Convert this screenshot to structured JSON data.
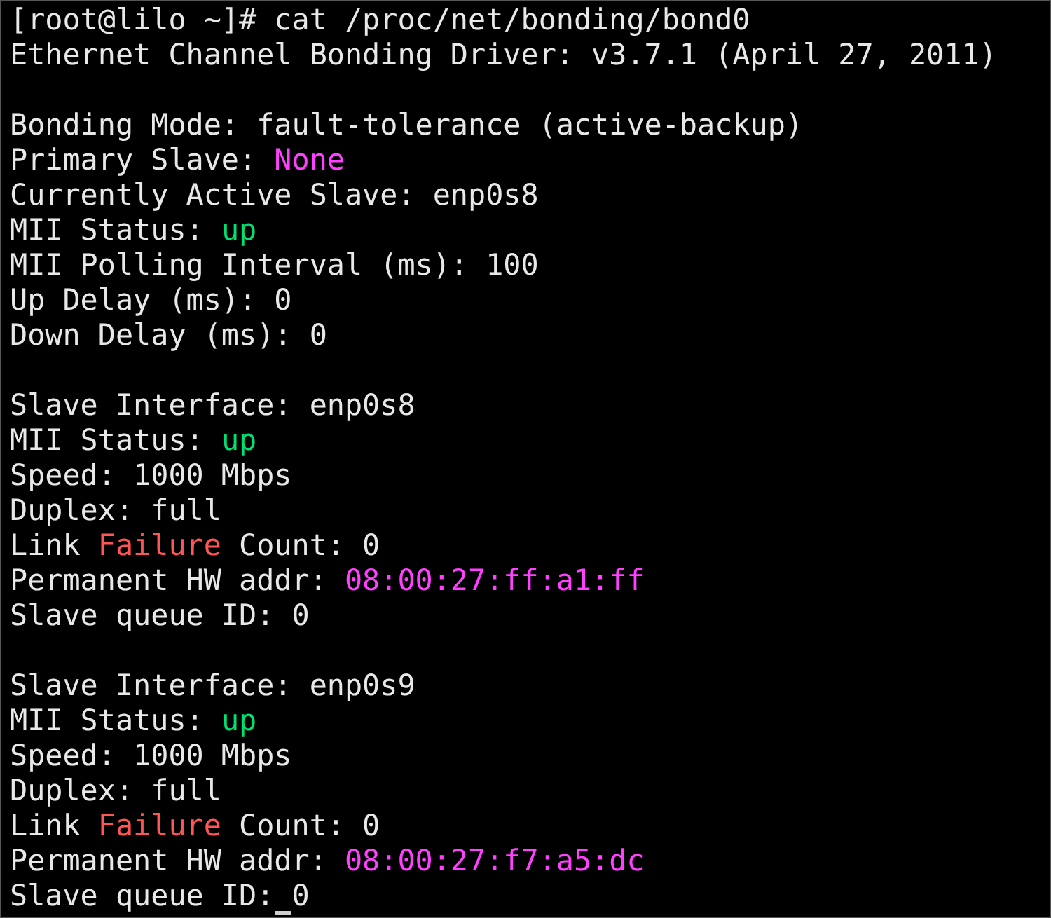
{
  "terminal": {
    "lines": [
      {
        "kind": "text",
        "segments": [
          {
            "text": "[root@lilo ~]# cat /proc/net/bonding/bond0"
          }
        ]
      },
      {
        "kind": "text",
        "segments": [
          {
            "text": "Ethernet Channel Bonding Driver: v3.7.1 (April 27, 2011)"
          }
        ]
      },
      {
        "kind": "blank"
      },
      {
        "kind": "text",
        "segments": [
          {
            "text": "Bonding Mode: fault-tolerance (active-backup)"
          }
        ]
      },
      {
        "kind": "text",
        "segments": [
          {
            "text": "Primary Slave: "
          },
          {
            "text": "None",
            "color": "#ff40ff"
          }
        ]
      },
      {
        "kind": "text",
        "segments": [
          {
            "text": "Currently Active Slave: enp0s8"
          }
        ]
      },
      {
        "kind": "text",
        "segments": [
          {
            "text": "MII Status: "
          },
          {
            "text": "up",
            "color": "#00e070"
          }
        ]
      },
      {
        "kind": "text",
        "segments": [
          {
            "text": "MII Polling Interval (ms): 100"
          }
        ]
      },
      {
        "kind": "text",
        "segments": [
          {
            "text": "Up Delay (ms): 0"
          }
        ]
      },
      {
        "kind": "text",
        "segments": [
          {
            "text": "Down Delay (ms): 0"
          }
        ]
      },
      {
        "kind": "blank"
      },
      {
        "kind": "text",
        "segments": [
          {
            "text": "Slave Interface: enp0s8"
          }
        ]
      },
      {
        "kind": "text",
        "segments": [
          {
            "text": "MII Status: "
          },
          {
            "text": "up",
            "color": "#00e070"
          }
        ]
      },
      {
        "kind": "text",
        "segments": [
          {
            "text": "Speed: 1000 Mbps"
          }
        ]
      },
      {
        "kind": "text",
        "segments": [
          {
            "text": "Duplex: full"
          }
        ]
      },
      {
        "kind": "text",
        "segments": [
          {
            "text": "Link "
          },
          {
            "text": "Failure",
            "color": "#ff5555"
          },
          {
            "text": " Count: 0"
          }
        ]
      },
      {
        "kind": "text",
        "segments": [
          {
            "text": "Permanent HW addr: "
          },
          {
            "text": "08:00:27:ff:a1:ff",
            "color": "#ff40ff"
          }
        ]
      },
      {
        "kind": "text",
        "segments": [
          {
            "text": "Slave queue ID: 0"
          }
        ]
      },
      {
        "kind": "blank"
      },
      {
        "kind": "text",
        "segments": [
          {
            "text": "Slave Interface: enp0s9"
          }
        ]
      },
      {
        "kind": "text",
        "segments": [
          {
            "text": "MII Status: "
          },
          {
            "text": "up",
            "color": "#00e070"
          }
        ]
      },
      {
        "kind": "text",
        "segments": [
          {
            "text": "Speed: 1000 Mbps"
          }
        ]
      },
      {
        "kind": "text",
        "segments": [
          {
            "text": "Duplex: full"
          }
        ]
      },
      {
        "kind": "text",
        "segments": [
          {
            "text": "Link "
          },
          {
            "text": "Failure",
            "color": "#ff5555"
          },
          {
            "text": " Count: 0"
          }
        ]
      },
      {
        "kind": "text",
        "segments": [
          {
            "text": "Permanent HW addr: "
          },
          {
            "text": "08:00:27:f7:a5:dc",
            "color": "#ff40ff"
          }
        ]
      },
      {
        "kind": "text",
        "segments": [
          {
            "text": "Slave queue ID:"
          },
          {
            "text": " 0",
            "cursor": true
          }
        ]
      }
    ]
  }
}
